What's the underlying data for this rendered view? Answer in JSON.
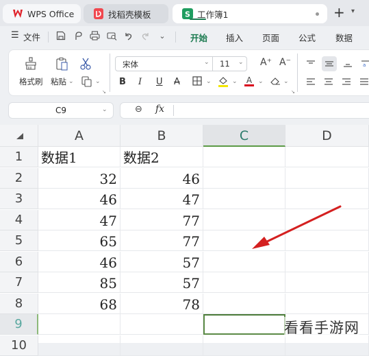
{
  "window": {
    "tabs": [
      {
        "label": "WPS Office",
        "icon": "wps-logo-icon",
        "active": false
      },
      {
        "label": "找稻壳模板",
        "icon": "docer-template-icon",
        "active": false
      },
      {
        "label": "工作簿1",
        "icon": "spreadsheet-icon",
        "active": true,
        "unsaved": true
      }
    ],
    "new_tab": "+",
    "tab_menu": "⌄"
  },
  "menu": {
    "file_label": "文件",
    "quick_access": [
      "save-icon",
      "share-icon",
      "print-icon",
      "print-preview-icon",
      "undo-icon",
      "redo-icon",
      "more-chevron-icon"
    ],
    "ribbon_tabs": [
      {
        "label": "开始",
        "active": true
      },
      {
        "label": "插入",
        "active": false
      },
      {
        "label": "页面",
        "active": false
      },
      {
        "label": "公式",
        "active": false
      },
      {
        "label": "数据",
        "active": false
      }
    ]
  },
  "ribbon": {
    "format_painter": "格式刷",
    "paste": "粘贴",
    "font_name": "宋体",
    "font_size": "11",
    "bold": "B",
    "italic": "I",
    "underline": "U",
    "strikethrough": "A",
    "grow_font": "A⁺",
    "shrink_font": "A⁻",
    "fill_color": "#f2e600",
    "font_color": "#d9001b"
  },
  "formula_bar": {
    "name_box": "C9",
    "zoom_icon": "⊖",
    "fx_label": "fx",
    "formula": ""
  },
  "sheet": {
    "columns": [
      "A",
      "B",
      "C",
      "D"
    ],
    "selected_column": "C",
    "rows": [
      {
        "n": "1",
        "a": "数据1",
        "b": "数据2"
      },
      {
        "n": "2",
        "a": "32",
        "b": "46"
      },
      {
        "n": "3",
        "a": "46",
        "b": "47"
      },
      {
        "n": "4",
        "a": "47",
        "b": "77"
      },
      {
        "n": "5",
        "a": "65",
        "b": "77"
      },
      {
        "n": "6",
        "a": "46",
        "b": "57"
      },
      {
        "n": "7",
        "a": "85",
        "b": "57"
      },
      {
        "n": "8",
        "a": "68",
        "b": "78"
      },
      {
        "n": "9",
        "a": "",
        "b": ""
      },
      {
        "n": "10",
        "a": "",
        "b": ""
      }
    ],
    "active_cell": "C9"
  },
  "annotation": {
    "arrow_color": "#d42020"
  },
  "watermark": "看看手游网"
}
